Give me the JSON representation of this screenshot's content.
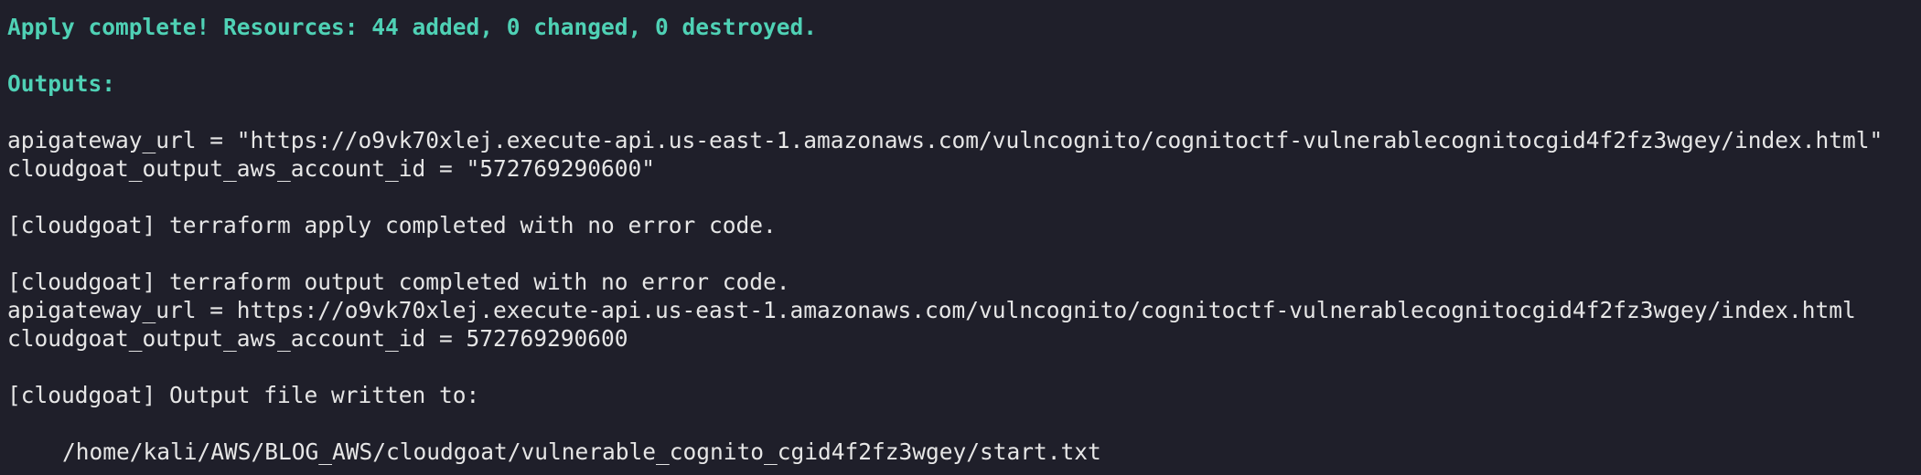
{
  "terminal": {
    "colors": {
      "background": "#1f1f2a",
      "text": "#e6e6e6",
      "highlight": "#4fd1b5"
    },
    "lines": [
      {
        "text": "Apply complete! Resources: 44 added, 0 changed, 0 destroyed."
      },
      {
        "text": ""
      },
      {
        "text": "Outputs:"
      },
      {
        "text": ""
      },
      {
        "text": "apigateway_url = \"https://o9vk70xlej.execute-api.us-east-1.amazonaws.com/vulncognito/cognitoctf-vulnerablecognitocgid4f2fz3wgey/index.html\""
      },
      {
        "text": "cloudgoat_output_aws_account_id = \"572769290600\""
      },
      {
        "text": ""
      },
      {
        "text": "[cloudgoat] terraform apply completed with no error code."
      },
      {
        "text": ""
      },
      {
        "text": "[cloudgoat] terraform output completed with no error code."
      },
      {
        "text": "apigateway_url = https://o9vk70xlej.execute-api.us-east-1.amazonaws.com/vulncognito/cognitoctf-vulnerablecognitocgid4f2fz3wgey/index.html"
      },
      {
        "text": "cloudgoat_output_aws_account_id = 572769290600"
      },
      {
        "text": ""
      },
      {
        "text": "[cloudgoat] Output file written to:"
      },
      {
        "text": ""
      },
      {
        "text": "/home/kali/AWS/BLOG_AWS/cloudgoat/vulnerable_cognito_cgid4f2fz3wgey/start.txt"
      }
    ]
  }
}
